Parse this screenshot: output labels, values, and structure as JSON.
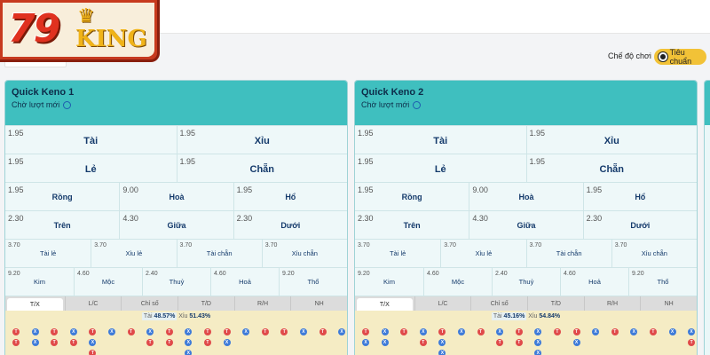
{
  "brand": {
    "logo_number": "79",
    "logo_word": "KING"
  },
  "mode": {
    "label": "Chế độ chơi",
    "toggle_label": "Tiêu chuẩn"
  },
  "colors": {
    "accent": "#3fbfbf",
    "toggle": "#f2c237",
    "tai": "#e04a4a",
    "xiu": "#3e7bd9"
  },
  "panels": [
    {
      "title": "Quick Keno 1",
      "status": "Chờ lượt mới",
      "row1": [
        {
          "odds": "1.95",
          "label": "Tài"
        },
        {
          "odds": "1.95",
          "label": "Xỉu"
        }
      ],
      "row2": [
        {
          "odds": "1.95",
          "label": "Lẻ"
        },
        {
          "odds": "1.95",
          "label": "Chẵn"
        }
      ],
      "row3": [
        {
          "odds": "1.95",
          "label": "Rồng"
        },
        {
          "odds": "9.00",
          "label": "Hoà"
        },
        {
          "odds": "1.95",
          "label": "Hổ"
        }
      ],
      "row4": [
        {
          "odds": "2.30",
          "label": "Trên"
        },
        {
          "odds": "4.30",
          "label": "Giữa"
        },
        {
          "odds": "2.30",
          "label": "Dưới"
        }
      ],
      "row5": [
        {
          "odds": "3.70",
          "label": "Tài lẻ"
        },
        {
          "odds": "3.70",
          "label": "Xỉu lẻ"
        },
        {
          "odds": "3.70",
          "label": "Tài chẵn"
        },
        {
          "odds": "3.70",
          "label": "Xỉu chẵn"
        }
      ],
      "row6": [
        {
          "odds": "9.20",
          "label": "Kim"
        },
        {
          "odds": "4.60",
          "label": "Mộc"
        },
        {
          "odds": "2.40",
          "label": "Thuỷ"
        },
        {
          "odds": "4.60",
          "label": "Hoả"
        },
        {
          "odds": "9.20",
          "label": "Thổ"
        }
      ],
      "tabs": [
        "T/X",
        "L/C",
        "Chỉ số",
        "T/D",
        "R/H",
        "NH"
      ],
      "stats": {
        "tai_label": "Tài",
        "tai_value": "48.57%",
        "xiu_label": "Xỉu",
        "xiu_value": "51.43%"
      },
      "beads": [
        [
          "T",
          "X",
          "T",
          "X",
          "T",
          "X",
          "T",
          "X",
          "T",
          "X",
          "T",
          "T",
          "X",
          "T",
          "T",
          "X",
          "T",
          "X"
        ],
        [
          "T",
          "X",
          "T",
          "T",
          "X",
          "",
          "",
          "T",
          "T",
          "X",
          "T",
          "X",
          "",
          "",
          "",
          "",
          "",
          ""
        ],
        [
          "",
          "",
          "",
          "",
          "T",
          "",
          "",
          "",
          "",
          "X",
          "",
          "",
          "",
          "",
          "",
          "",
          "",
          ""
        ]
      ]
    },
    {
      "title": "Quick Keno 2",
      "status": "Chờ lượt mới",
      "row1": [
        {
          "odds": "1.95",
          "label": "Tài"
        },
        {
          "odds": "1.95",
          "label": "Xỉu"
        }
      ],
      "row2": [
        {
          "odds": "1.95",
          "label": "Lẻ"
        },
        {
          "odds": "1.95",
          "label": "Chẵn"
        }
      ],
      "row3": [
        {
          "odds": "1.95",
          "label": "Rồng"
        },
        {
          "odds": "9.00",
          "label": "Hoà"
        },
        {
          "odds": "1.95",
          "label": "Hổ"
        }
      ],
      "row4": [
        {
          "odds": "2.30",
          "label": "Trên"
        },
        {
          "odds": "4.30",
          "label": "Giữa"
        },
        {
          "odds": "2.30",
          "label": "Dưới"
        }
      ],
      "row5": [
        {
          "odds": "3.70",
          "label": "Tài lẻ"
        },
        {
          "odds": "3.70",
          "label": "Xỉu lẻ"
        },
        {
          "odds": "3.70",
          "label": "Tài chẵn"
        },
        {
          "odds": "3.70",
          "label": "Xỉu chẵn"
        }
      ],
      "row6": [
        {
          "odds": "9.20",
          "label": "Kim"
        },
        {
          "odds": "4.60",
          "label": "Mộc"
        },
        {
          "odds": "2.40",
          "label": "Thuỷ"
        },
        {
          "odds": "4.60",
          "label": "Hoả"
        },
        {
          "odds": "9.20",
          "label": "Thổ"
        }
      ],
      "tabs": [
        "T/X",
        "L/C",
        "Chỉ số",
        "T/D",
        "R/H",
        "NH"
      ],
      "stats": {
        "tai_label": "Tài",
        "tai_value": "45.16%",
        "xiu_label": "Xỉu",
        "xiu_value": "54.84%"
      },
      "beads": [
        [
          "T",
          "X",
          "T",
          "X",
          "T",
          "X",
          "T",
          "X",
          "T",
          "X",
          "T",
          "T",
          "X",
          "T",
          "X",
          "T",
          "X",
          "X"
        ],
        [
          "X",
          "X",
          "",
          "T",
          "X",
          "",
          "",
          "T",
          "T",
          "X",
          "",
          "X",
          "",
          "",
          "",
          "",
          "",
          "T"
        ],
        [
          "",
          "",
          "",
          "",
          "X",
          "",
          "",
          "",
          "",
          "X",
          "",
          "",
          "",
          "",
          "",
          "",
          "",
          ""
        ]
      ]
    }
  ]
}
